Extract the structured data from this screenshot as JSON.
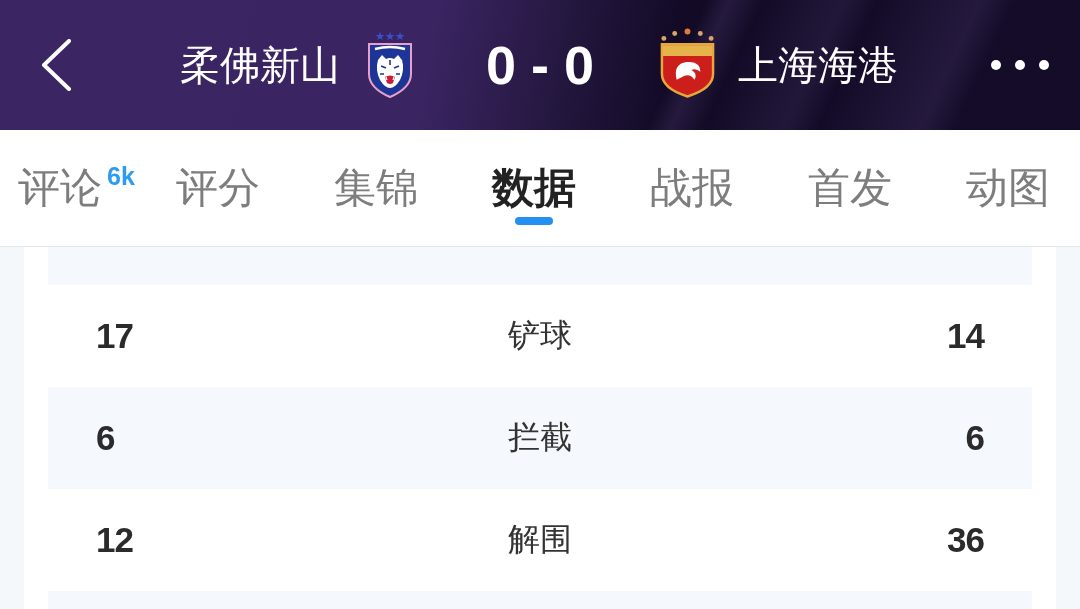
{
  "header": {
    "home_team": {
      "name": "柔佛新山"
    },
    "score": "0 - 0",
    "away_team": {
      "name": "上海海港"
    }
  },
  "tabs": [
    {
      "label": "评论",
      "badge": "6k",
      "selected": false
    },
    {
      "label": "评分",
      "selected": false
    },
    {
      "label": "集锦",
      "selected": false
    },
    {
      "label": "数据",
      "selected": true
    },
    {
      "label": "战报",
      "selected": false
    },
    {
      "label": "首发",
      "selected": false
    },
    {
      "label": "动图",
      "selected": false
    }
  ],
  "stats": [
    {
      "home": "17",
      "label": "铲球",
      "away": "14"
    },
    {
      "home": "6",
      "label": "拦截",
      "away": "6"
    },
    {
      "home": "12",
      "label": "解围",
      "away": "36"
    }
  ]
}
